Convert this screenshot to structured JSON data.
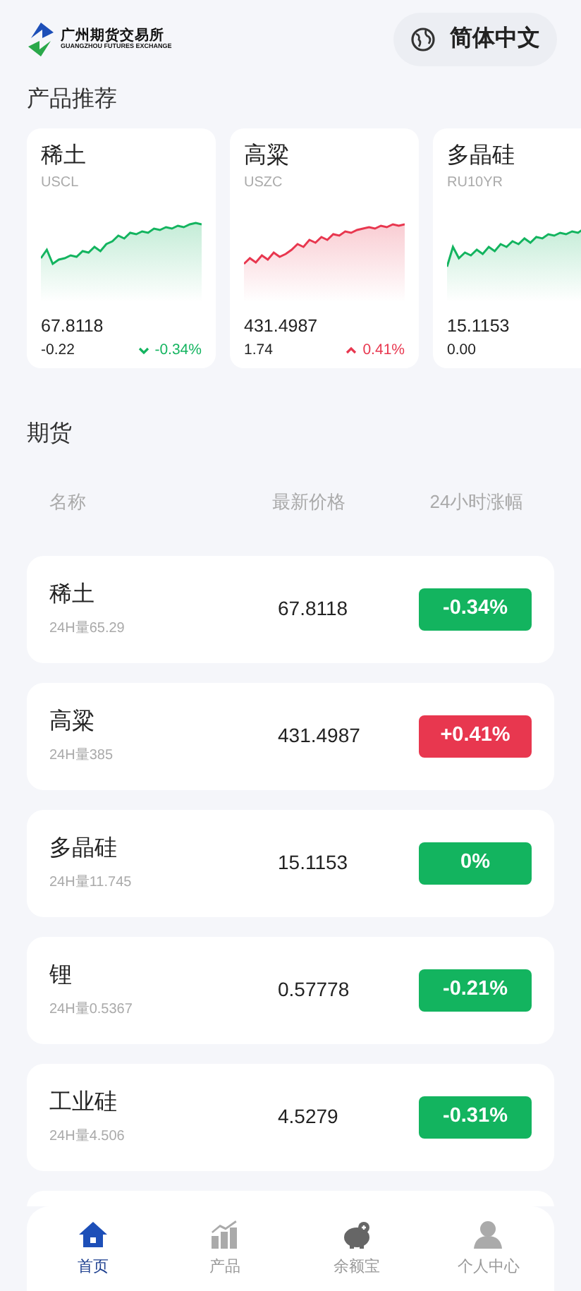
{
  "header": {
    "logo_name": "广州期货交易所",
    "logo_subtitle": "GUANGZHOU FUTURES EXCHANGE",
    "language_button": "简体中文"
  },
  "recommend": {
    "title": "产品推荐",
    "cards": [
      {
        "name": "稀土",
        "code": "USCL",
        "price": "67.8118",
        "change": "-0.22",
        "percent": {
          "text": "-0.34%",
          "kind": "fall"
        },
        "color": "#13b45f"
      },
      {
        "name": "高粱",
        "code": "USZC",
        "price": "431.4987",
        "change": "1.74",
        "percent": {
          "text": "0.41%",
          "kind": "rise"
        },
        "color": "#e8374f"
      },
      {
        "name": "多晶硅",
        "code": "RU10YR",
        "price": "15.1153",
        "change": "0.00",
        "color": "#13b45f"
      }
    ]
  },
  "futures": {
    "title": "期货",
    "columns": [
      "名称",
      "最新价格",
      "24小时涨幅"
    ],
    "rows": [
      {
        "name": "稀土",
        "volume": "24H量65.29",
        "price": "67.8118",
        "percent": "-0.34%",
        "color": "#13b45f"
      },
      {
        "name": "高粱",
        "volume": "24H量385",
        "price": "431.4987",
        "percent": "+0.41%",
        "color": "#e8374f"
      },
      {
        "name": "多晶硅",
        "volume": "24H量11.745",
        "price": "15.1153",
        "percent": "0%",
        "color": "#13b45f"
      },
      {
        "name": "锂",
        "volume": "24H量0.5367",
        "price": "0.57778",
        "percent": "-0.21%",
        "color": "#13b45f"
      },
      {
        "name": "工业硅",
        "volume": "24H量4.506",
        "price": "4.5279",
        "percent": "-0.31%",
        "color": "#13b45f"
      }
    ]
  },
  "tab_bar": [
    {
      "label": "首页",
      "selected": true
    },
    {
      "label": "产品",
      "selected": false
    },
    {
      "label": "余额宝",
      "selected": false
    },
    {
      "label": "个人中心",
      "selected": false
    }
  ]
}
